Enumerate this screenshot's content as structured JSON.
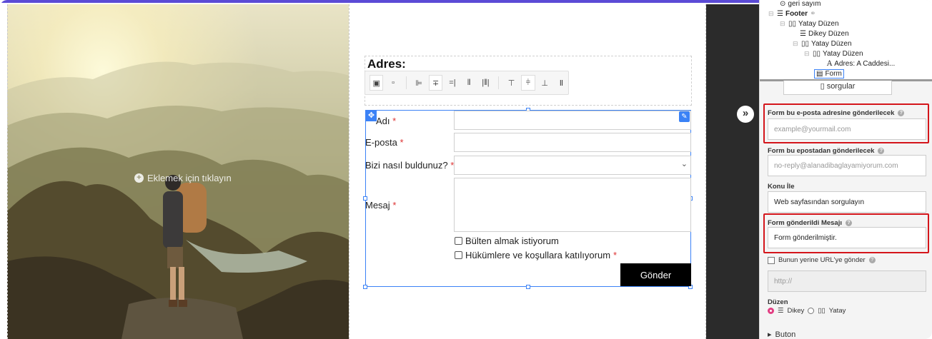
{
  "canvas": {
    "add_hint": "Eklemek için tıklayın"
  },
  "address_block": {
    "title": "Adres:"
  },
  "form": {
    "fields": [
      {
        "label": "Adı",
        "required_mark": "*"
      },
      {
        "label": "E-posta",
        "required_mark": "*"
      },
      {
        "label": "Bizi nasıl buldunuz?",
        "required_mark": "*"
      },
      {
        "label": "Mesaj",
        "required_mark": "*"
      }
    ],
    "checkboxes": [
      {
        "label": "Bülten almak istiyorum",
        "required_mark": ""
      },
      {
        "label": "Hükümlere ve koşullara katılıyorum",
        "required_mark": "*"
      }
    ],
    "submit_label": "Gönder"
  },
  "tree": {
    "items": [
      {
        "label": "geri sayım"
      },
      {
        "label": "Footer"
      },
      {
        "label": "Yatay Düzen"
      },
      {
        "label": "Dikey Düzen"
      },
      {
        "label": "Yatay Düzen"
      },
      {
        "label": "Yatay Düzen"
      },
      {
        "label": "Adres: A Caddesi..."
      },
      {
        "label": "Form"
      },
      {
        "label": "sorgular"
      }
    ]
  },
  "settings": {
    "send_to_label": "Form bu e-posta adresine gönderilecek",
    "send_to_placeholder": "example@yourmail.com",
    "send_from_label": "Form bu epostadan gönderilecek",
    "send_from_placeholder": "no-reply@alanadibaglayamiyorum.com",
    "subject_label": "Konu İle",
    "subject_value": "Web sayfasından sorgulayın",
    "sent_message_label": "Form gönderildi Mesajı",
    "sent_message_value": "Form gönderilmiştir.",
    "redirect_label": "Bunun yerine URL'ye gönder",
    "redirect_placeholder": "http://",
    "layout_label": "Düzen",
    "layout_vertical": "Dikey",
    "layout_horizontal": "Yatay",
    "button_section": "Buton"
  },
  "colors": {
    "accent": "#3b82f6",
    "highlight": "#d4151b",
    "radio_active": "#e23d82"
  }
}
